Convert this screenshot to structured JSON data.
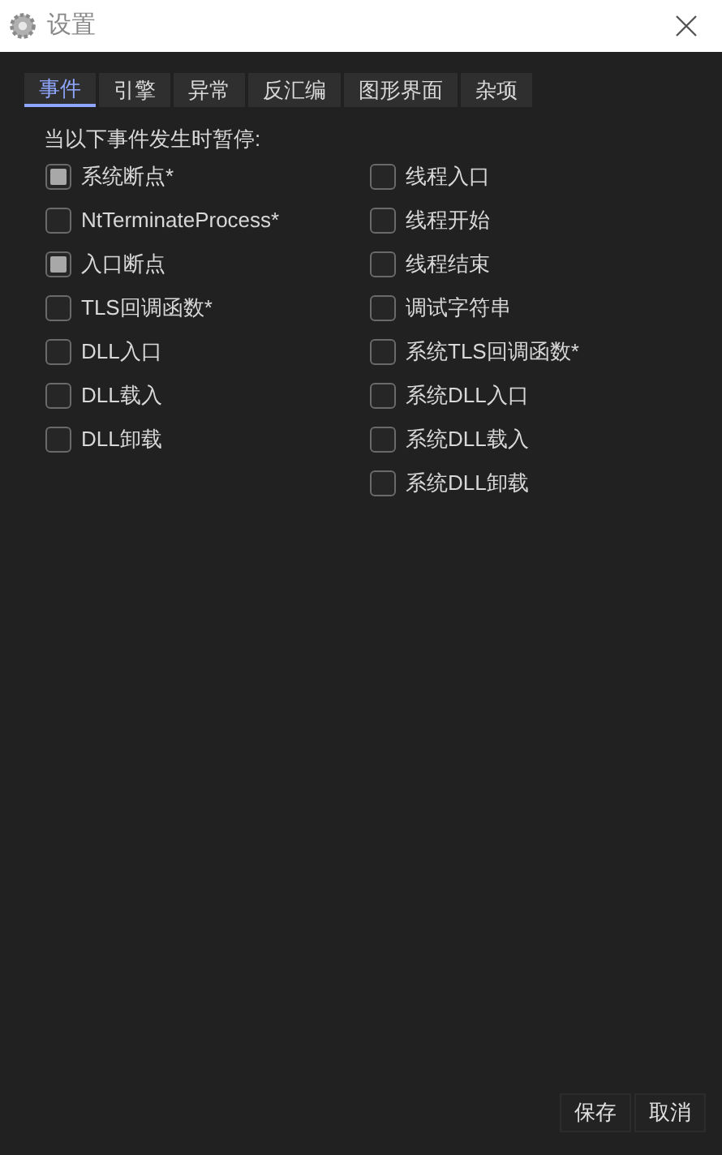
{
  "window": {
    "title": "设置"
  },
  "tabs": [
    {
      "label": "事件",
      "selected": true
    },
    {
      "label": "引擎",
      "selected": false
    },
    {
      "label": "异常",
      "selected": false
    },
    {
      "label": "反汇编",
      "selected": false
    },
    {
      "label": "图形界面",
      "selected": false
    },
    {
      "label": "杂项",
      "selected": false
    }
  ],
  "section_label": "当以下事件发生时暂停:",
  "left_column": [
    {
      "label": "系统断点*",
      "checked": true
    },
    {
      "label": "NtTerminateProcess*",
      "checked": false
    },
    {
      "label": "入口断点",
      "checked": true
    },
    {
      "label": "TLS回调函数*",
      "checked": false
    },
    {
      "label": "DLL入口",
      "checked": false
    },
    {
      "label": "DLL载入",
      "checked": false
    },
    {
      "label": "DLL卸载",
      "checked": false
    }
  ],
  "right_column": [
    {
      "label": "线程入口",
      "checked": false
    },
    {
      "label": "线程开始",
      "checked": false
    },
    {
      "label": "线程结束",
      "checked": false
    },
    {
      "label": "调试字符串",
      "checked": false
    },
    {
      "label": "系统TLS回调函数*",
      "checked": false
    },
    {
      "label": "系统DLL入口",
      "checked": false
    },
    {
      "label": "系统DLL载入",
      "checked": false
    },
    {
      "label": "系统DLL卸载",
      "checked": false
    }
  ],
  "buttons": [
    "保存",
    "取消"
  ]
}
